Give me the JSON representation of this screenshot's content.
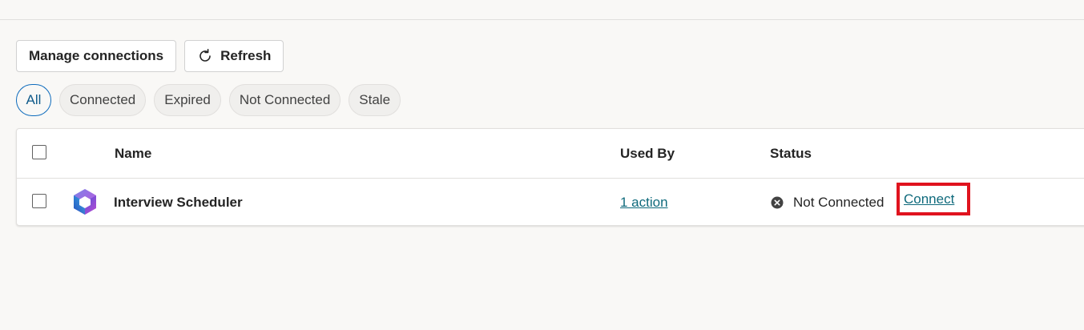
{
  "toolbar": {
    "manage_label": "Manage connections",
    "refresh_label": "Refresh"
  },
  "filters": [
    {
      "label": "All",
      "active": true
    },
    {
      "label": "Connected",
      "active": false
    },
    {
      "label": "Expired",
      "active": false
    },
    {
      "label": "Not Connected",
      "active": false
    },
    {
      "label": "Stale",
      "active": false
    }
  ],
  "table": {
    "columns": {
      "name": "Name",
      "used_by": "Used By",
      "status": "Status"
    },
    "rows": [
      {
        "name": "Interview Scheduler",
        "used_by": "1 action",
        "status": "Not Connected",
        "action": "Connect",
        "icon": "microsoft-365-logo"
      }
    ]
  },
  "colors": {
    "link": "#0f6a7c",
    "highlight": "#e0131e",
    "accent": "#0f6cbd"
  }
}
